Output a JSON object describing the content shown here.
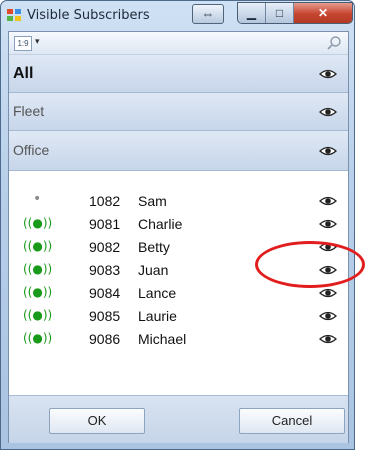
{
  "window": {
    "title": "Visible Subscribers"
  },
  "toolbar": {
    "sort_icon_text": "1:9",
    "dropdown_glyph": "▾"
  },
  "groups": [
    {
      "label": "All"
    },
    {
      "label": "Fleet"
    },
    {
      "label": "Office"
    }
  ],
  "subscribers": [
    {
      "status": "idle",
      "status_glyph": "•",
      "id": "1082",
      "name": "Sam"
    },
    {
      "status": "active",
      "status_glyph": "((●))",
      "id": "9081",
      "name": "Charlie"
    },
    {
      "status": "active",
      "status_glyph": "((●))",
      "id": "9082",
      "name": "Betty"
    },
    {
      "status": "active",
      "status_glyph": "((●))",
      "id": "9083",
      "name": "Juan"
    },
    {
      "status": "active",
      "status_glyph": "((●))",
      "id": "9084",
      "name": "Lance"
    },
    {
      "status": "active",
      "status_glyph": "((●))",
      "id": "9085",
      "name": "Laurie"
    },
    {
      "status": "active",
      "status_glyph": "((●))",
      "id": "9086",
      "name": "Michael"
    }
  ],
  "buttons": {
    "ok": "OK",
    "cancel": "Cancel"
  },
  "icons": {
    "visibility": "eye-icon",
    "search": "search-icon",
    "status_active": "radio-signal-icon"
  },
  "colors": {
    "highlight": "#e21d1d",
    "active_status": "#1a9a1a"
  }
}
